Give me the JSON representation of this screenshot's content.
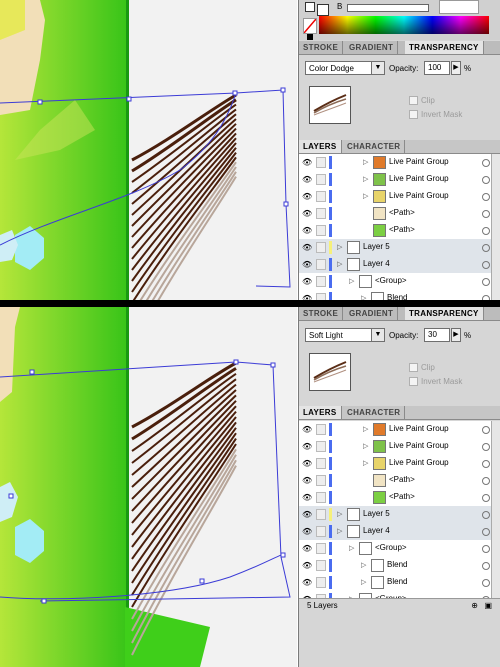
{
  "top": {
    "color_panel": {
      "fill_letter": "B"
    },
    "tabs": [
      "STROKE",
      "GRADIENT",
      "TRANSPARENCY"
    ],
    "blend_mode": "Color Dodge",
    "opacity_label": "Opacity:",
    "opacity_value": "100",
    "opacity_unit": "%",
    "clip_label": "Clip",
    "invert_mask_label": "Invert Mask",
    "layer_tabs": [
      "LAYERS",
      "CHARACTER"
    ],
    "layers": [
      {
        "name": "Live Paint Group",
        "thumb_color": "#e07a2a"
      },
      {
        "name": "Live Paint Group",
        "thumb_color": "#7fc24a"
      },
      {
        "name": "Live Paint Group",
        "thumb_color": "#e8d46a"
      },
      {
        "name": "<Path>",
        "thumb_color": "#f1e4c4"
      },
      {
        "name": "<Path>",
        "thumb_color": "#7ccf43"
      },
      {
        "name": "Layer 5",
        "thumb_color": "#ffffff"
      },
      {
        "name": "Layer 4",
        "thumb_color": "#ffffff"
      },
      {
        "name": "<Group>",
        "thumb_color": "#ffffff"
      },
      {
        "name": "Blend",
        "thumb_color": "#ffffff"
      }
    ]
  },
  "bottom": {
    "tabs": [
      "STROKE",
      "GRADIENT",
      "TRANSPARENCY"
    ],
    "blend_mode": "Soft Light",
    "opacity_label": "Opacity:",
    "opacity_value": "30",
    "opacity_unit": "%",
    "clip_label": "Clip",
    "invert_mask_label": "Invert Mask",
    "layer_tabs": [
      "LAYERS",
      "CHARACTER"
    ],
    "layers": [
      {
        "name": "Live Paint Group",
        "thumb_color": "#e07a2a"
      },
      {
        "name": "Live Paint Group",
        "thumb_color": "#7fc24a"
      },
      {
        "name": "Live Paint Group",
        "thumb_color": "#e8d46a"
      },
      {
        "name": "<Path>",
        "thumb_color": "#f1e4c4"
      },
      {
        "name": "<Path>",
        "thumb_color": "#7ccf43"
      },
      {
        "name": "Layer 5",
        "thumb_color": "#ffffff"
      },
      {
        "name": "Layer 4",
        "thumb_color": "#ffffff"
      },
      {
        "name": "<Group>",
        "thumb_color": "#ffffff"
      },
      {
        "name": "Blend",
        "thumb_color": "#ffffff"
      },
      {
        "name": "Blend",
        "thumb_color": "#ffffff"
      },
      {
        "name": "<Group>",
        "thumb_color": "#ffffff"
      }
    ],
    "footer_label": "5 Layers"
  },
  "colors": {
    "accent_green": "#3fcf1a",
    "bounding_box": "#3b3bd6",
    "stroke_dark": "#4a1f0c",
    "panel_bg": "#d6d6d6"
  }
}
